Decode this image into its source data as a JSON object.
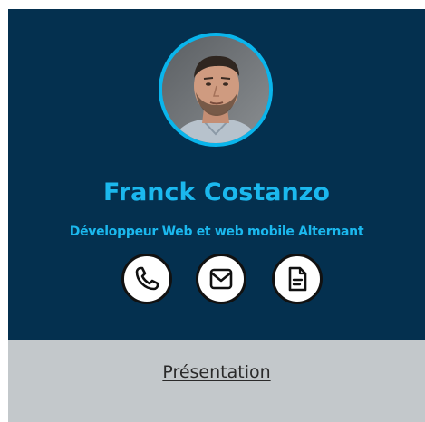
{
  "profile": {
    "name": "Franck Costanzo",
    "job_title": "Développeur Web et web mobile Alternant"
  },
  "contacts": [
    {
      "icon": "phone-icon"
    },
    {
      "icon": "mail-icon"
    },
    {
      "icon": "document-icon"
    }
  ],
  "section": {
    "link_label": "Présentation"
  },
  "colors": {
    "header_background": "#04304f",
    "accent": "#1bb8ee",
    "section_background": "#c3c8cb"
  }
}
